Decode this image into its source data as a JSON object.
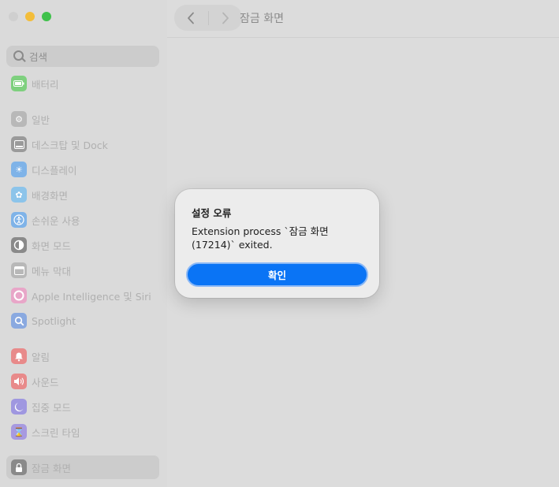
{
  "window": {
    "title": "잠금 화면"
  },
  "sidebar": {
    "search_placeholder": "검색",
    "items": [
      {
        "label": "배터리",
        "icon": "battery-icon",
        "color": "#7ed07e",
        "selected": false
      },
      {
        "label": "일반",
        "icon": "gear-icon",
        "color": "#b8b8b8",
        "selected": false
      },
      {
        "label": "데스크탑 및 Dock",
        "icon": "dock-icon",
        "color": "#9a9a9a",
        "selected": false
      },
      {
        "label": "디스플레이",
        "icon": "sun-icon",
        "color": "#7fb3e8",
        "selected": false
      },
      {
        "label": "배경화면",
        "icon": "wallpaper-icon",
        "color": "#8cc4ea",
        "selected": false
      },
      {
        "label": "손쉬운 사용",
        "icon": "accessibility-icon",
        "color": "#7fb3e8",
        "selected": false
      },
      {
        "label": "화면 모드",
        "icon": "appearance-icon",
        "color": "#8a8a8a",
        "selected": false
      },
      {
        "label": "메뉴 막대",
        "icon": "menubar-icon",
        "color": "#b8b8b8",
        "selected": false
      },
      {
        "label": "Apple Intelligence 및 Siri",
        "icon": "siri-icon",
        "color": "#e8a6c8",
        "selected": false
      },
      {
        "label": "Spotlight",
        "icon": "spotlight-icon",
        "color": "#8aa9e0",
        "selected": false
      },
      {
        "label": "알림",
        "icon": "bell-icon",
        "color": "#e88a8a",
        "selected": false
      },
      {
        "label": "사운드",
        "icon": "speaker-icon",
        "color": "#e88a8a",
        "selected": false
      },
      {
        "label": "집중 모드",
        "icon": "moon-icon",
        "color": "#9f97e0",
        "selected": false
      },
      {
        "label": "스크린 타임",
        "icon": "hourglass-icon",
        "color": "#a79ae0",
        "selected": false
      },
      {
        "label": "잠금 화면",
        "icon": "lock-icon",
        "color": "#8a8a8a",
        "selected": true
      }
    ]
  },
  "dialog": {
    "title": "설정 오류",
    "message": "Extension process `잠금 화면 (17214)` exited.",
    "confirm_label": "확인"
  }
}
